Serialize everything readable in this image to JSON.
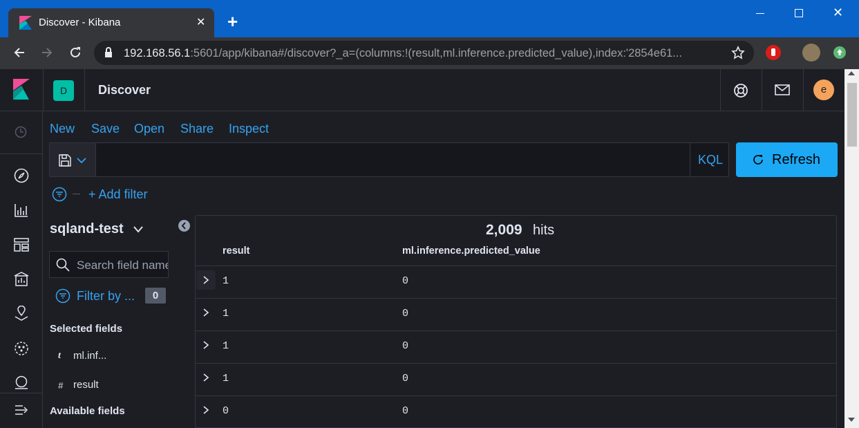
{
  "browser": {
    "tab_title": "Discover - Kibana",
    "new_tab": "+",
    "url_host": "192.168.56.1",
    "url_rest": ":5601/app/kibana#/discover?_a=(columns:!(result,ml.inference.predicted_value),index:'2854e61...",
    "window_controls": {
      "minimize": "—",
      "maximize": "☐",
      "close": "✕"
    }
  },
  "kibana": {
    "space_avatar": "D",
    "page_title": "Discover",
    "user_avatar": "e",
    "top_menu": [
      "New",
      "Save",
      "Open",
      "Share",
      "Inspect"
    ],
    "query_language": "KQL",
    "refresh_label": "Refresh",
    "add_filter_label": "+ Add filter",
    "index_pattern": "sqland-test",
    "search_placeholder": "Search field names",
    "filter_by_label": "Filter by ...",
    "filter_count": "0",
    "selected_fields_heading": "Selected fields",
    "selected_fields": [
      {
        "type": "t",
        "name": "ml.inf..."
      },
      {
        "type": "#",
        "name": "result"
      }
    ],
    "available_fields_heading": "Available fields",
    "hits_count": "2,009",
    "hits_label": "hits",
    "columns": [
      "result",
      "ml.inference.predicted_value"
    ],
    "rows": [
      [
        "1",
        "0"
      ],
      [
        "1",
        "0"
      ],
      [
        "1",
        "0"
      ],
      [
        "1",
        "0"
      ],
      [
        "0",
        "0"
      ]
    ]
  }
}
